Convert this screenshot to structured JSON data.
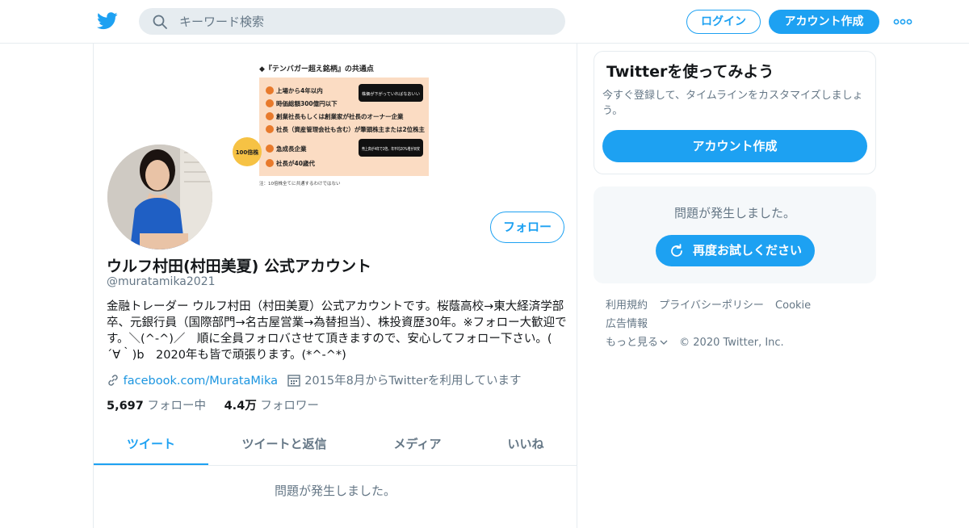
{
  "header": {
    "search_placeholder": "キーワード検索",
    "login_label": "ログイン",
    "signup_label": "アカウント作成"
  },
  "banner": {
    "title": "◆『テンバガー超え銘柄』の共通点",
    "badge": "100倍株",
    "items": [
      "上場から4年以内",
      "時価総額300億円以下",
      "創業社長もしくは創業家が社長のオーナー企業",
      "社長（資産管理会社も含む）が筆頭株主または2位株主",
      "急成長企業",
      "社長が40歳代"
    ],
    "callout1": "株価が下がっていればなおいい",
    "callout2": "売上高が4年で2倍。年平均20%増が目安",
    "note": "注：10倍株全てに共通するわけではない"
  },
  "profile": {
    "follow_label": "フォロー",
    "name": "ウルフ村田(村田美夏) 公式アカウント",
    "handle": "@muratamika2021",
    "bio": "金融トレーダー ウルフ村田（村田美夏）公式アカウントです。桜蔭高校→東大経済学部卒、元銀行員（国際部門→名古屋営業→為替担当）、株投資歴30年。※フォロー大歓迎です。＼(^-^)／　順に全員フォロバさせて頂きますので、安心してフォロー下さい。(　´∀｀)b　2020年も皆で頑張ります。(*^-^*)",
    "website": "facebook.com/MurataMika",
    "joined": "2015年8月からTwitterを利用しています",
    "following_count": "5,697",
    "following_label": "フォロー中",
    "followers_count": "4.4万",
    "followers_label": "フォロワー"
  },
  "tabs": [
    "ツイート",
    "ツイートと返信",
    "メディア",
    "いいね"
  ],
  "timeline": {
    "error": "問題が発生しました。"
  },
  "sidebar": {
    "promo_title": "Twitterを使ってみよう",
    "promo_text": "今すぐ登録して、タイムラインをカスタマイズしましょう。",
    "promo_button": "アカウント作成",
    "error_msg": "問題が発生しました。",
    "retry_label": "再度お試しください"
  },
  "footer": {
    "links": [
      "利用規約",
      "プライバシーポリシー",
      "Cookie",
      "広告情報",
      "もっと見る"
    ],
    "copyright": "© 2020 Twitter, Inc."
  },
  "colors": {
    "accent": "#1da1f2",
    "muted": "#657786",
    "border": "#e6ecf0"
  }
}
